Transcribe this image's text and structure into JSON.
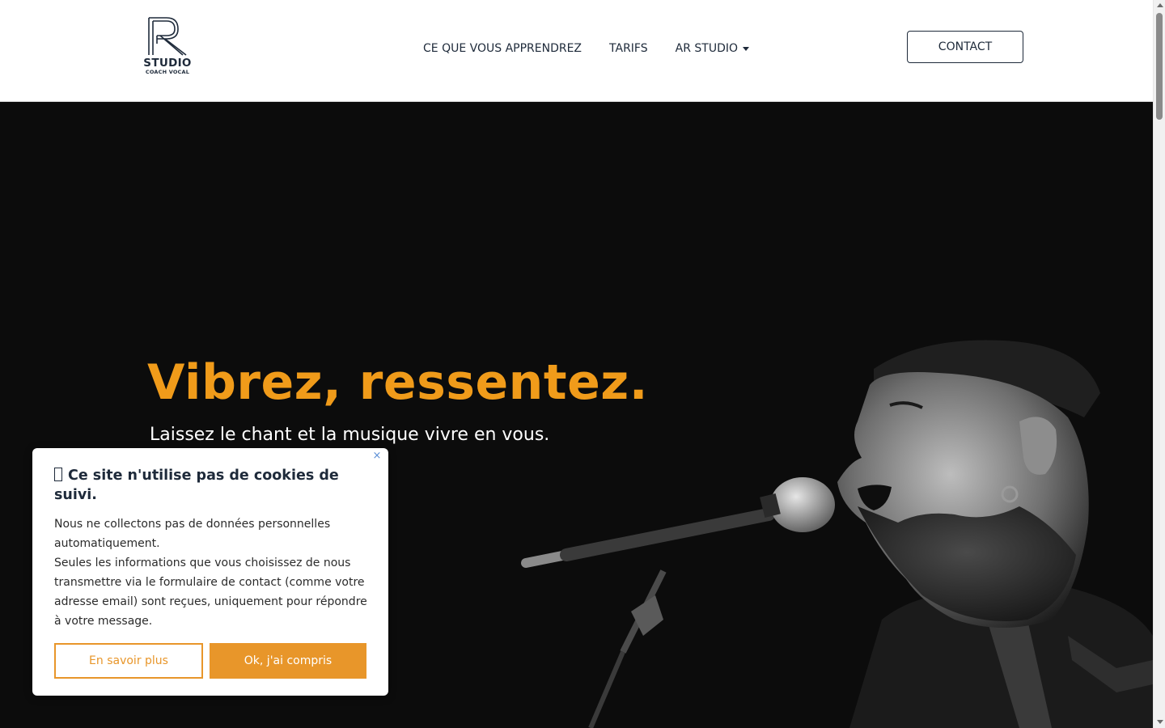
{
  "logo": {
    "brand": "STUDIO",
    "sub": "COACH VOCAL"
  },
  "nav": {
    "items": [
      {
        "label": "CE QUE VOUS APPRENDREZ"
      },
      {
        "label": "TARIFS"
      },
      {
        "label": "AR STUDIO",
        "has_dropdown": true
      }
    ],
    "contact_label": "CONTACT"
  },
  "hero": {
    "title": "Vibrez, ressentez.",
    "subtitle": "Laissez le chant et la musique vivre en vous.",
    "title_color": "#f09b1a"
  },
  "cookie": {
    "close_label": "×",
    "title": "Ce site n'utilise pas de cookies de suivi.",
    "paragraph1": "Nous ne collectons pas de données personnelles automatiquement.",
    "paragraph2": "Seules les informations que vous choisissez de nous transmettre via le formulaire de contact (comme votre adresse email) sont reçues, uniquement pour répondre à votre message.",
    "more_label": "En savoir plus",
    "ok_label": "Ok, j'ai compris",
    "accent_color": "#e8962a"
  }
}
